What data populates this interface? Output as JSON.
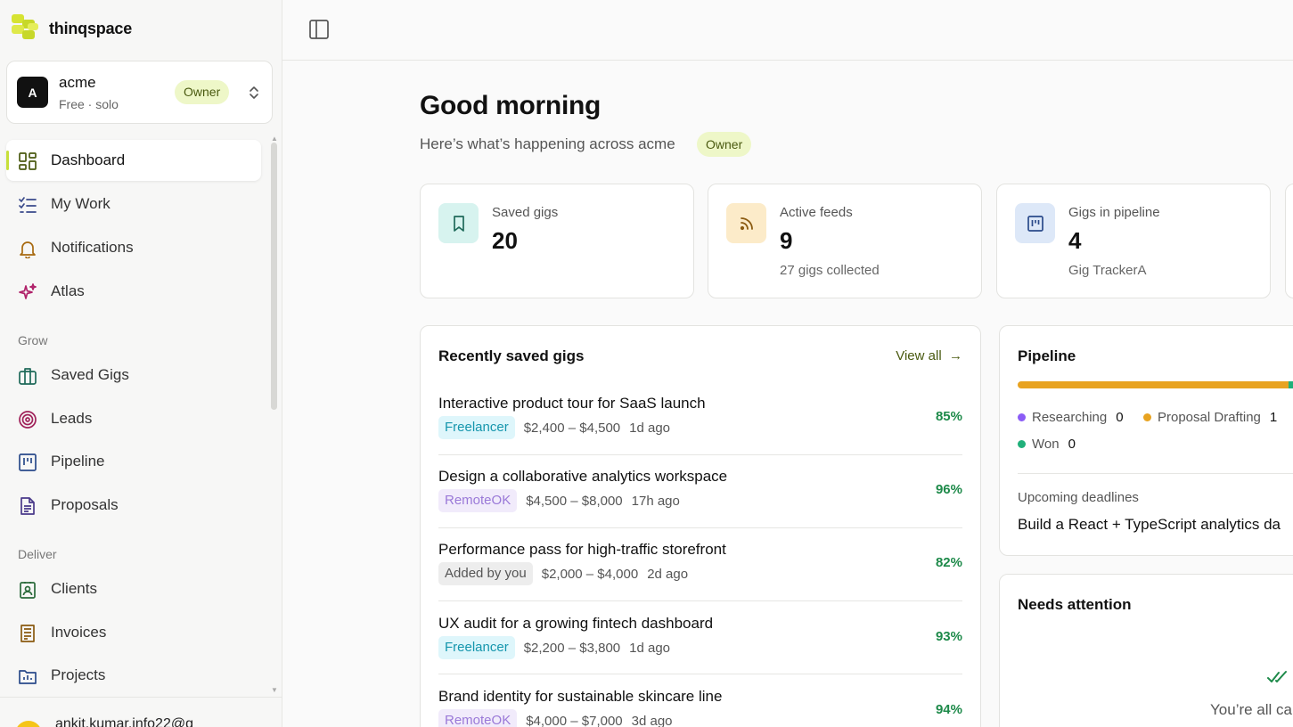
{
  "app": {
    "name": "thinqspace"
  },
  "org": {
    "avatar_letter": "A",
    "name": "acme",
    "plan": "Free · solo",
    "role": "Owner"
  },
  "nav": {
    "items": [
      {
        "label": "Dashboard",
        "icon": "dashboard-icon",
        "active": true
      },
      {
        "label": "My Work",
        "icon": "checklist-icon"
      },
      {
        "label": "Notifications",
        "icon": "bell-icon"
      },
      {
        "label": "Atlas",
        "icon": "sparkle-icon"
      }
    ],
    "grow_label": "Grow",
    "grow": [
      {
        "label": "Saved Gigs",
        "icon": "briefcase-icon"
      },
      {
        "label": "Leads",
        "icon": "target-icon"
      },
      {
        "label": "Pipeline",
        "icon": "kanban-icon"
      },
      {
        "label": "Proposals",
        "icon": "document-icon"
      }
    ],
    "deliver_label": "Deliver",
    "deliver": [
      {
        "label": "Clients",
        "icon": "contact-icon"
      },
      {
        "label": "Invoices",
        "icon": "receipt-icon"
      },
      {
        "label": "Projects",
        "icon": "folder-icon"
      }
    ]
  },
  "user": {
    "email": "ankit.kumar.info22@g"
  },
  "header": {
    "greeting": "Good morning",
    "subline": "Here’s what’s happening across acme",
    "role": "Owner"
  },
  "stats": [
    {
      "label": "Saved gigs",
      "value": "20",
      "sub": "",
      "icon": "bookmark-icon"
    },
    {
      "label": "Active feeds",
      "value": "9",
      "sub": "27 gigs collected",
      "icon": "rss-icon"
    },
    {
      "label": "Gigs in pipeline",
      "value": "4",
      "sub": "Gig TrackerA",
      "icon": "kanban-icon"
    }
  ],
  "recent": {
    "title": "Recently saved gigs",
    "view_all": "View all",
    "gigs": [
      {
        "title": "Interactive product tour for SaaS launch",
        "source": "Freelancer",
        "budget": "$2,400 – $4,500",
        "age": "1d ago",
        "score": "85%"
      },
      {
        "title": "Design a collaborative analytics workspace",
        "source": "RemoteOK",
        "budget": "$4,500 – $8,000",
        "age": "17h ago",
        "score": "96%"
      },
      {
        "title": "Performance pass for high-traffic storefront",
        "source": "Added by you",
        "budget": "$2,000 – $4,000",
        "age": "2d ago",
        "score": "82%"
      },
      {
        "title": "UX audit for a growing fintech dashboard",
        "source": "Freelancer",
        "budget": "$2,200 – $3,800",
        "age": "1d ago",
        "score": "93%"
      },
      {
        "title": "Brand identity for sustainable skincare line",
        "source": "RemoteOK",
        "budget": "$4,000 – $7,000",
        "age": "3d ago",
        "score": "94%"
      }
    ]
  },
  "pipeline": {
    "title": "Pipeline",
    "stages": [
      {
        "label": "Researching",
        "count": "0",
        "color": "#8b5cf6"
      },
      {
        "label": "Proposal Drafting",
        "count": "1",
        "color": "#e8a321"
      },
      {
        "label": "Won",
        "count": "0",
        "color": "#20b07a"
      }
    ],
    "upcoming_label": "Upcoming deadlines",
    "upcoming_item": "Build a React + TypeScript analytics da"
  },
  "attention": {
    "title": "Needs attention",
    "empty": "You’re all ca"
  },
  "colors": {
    "accent": "#c7df3a",
    "success": "#1e8a4a"
  }
}
